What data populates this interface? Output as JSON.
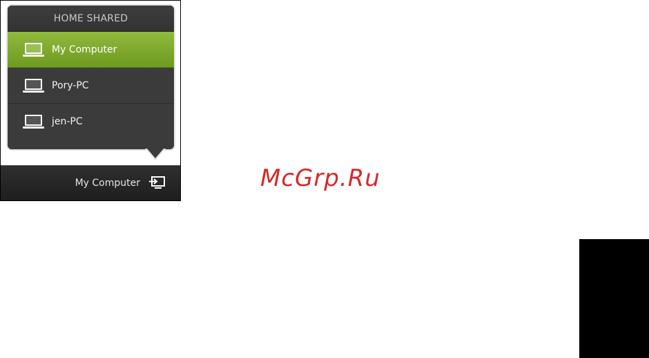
{
  "popup": {
    "title": "HOME SHARED",
    "items": [
      {
        "label": "My Computer",
        "icon": "laptop-icon",
        "selected": true
      },
      {
        "label": "Pory-PC",
        "icon": "laptop-icon",
        "selected": false
      },
      {
        "label": "jen-PC",
        "icon": "laptop-icon",
        "selected": false
      }
    ]
  },
  "bottom_bar": {
    "current_source": "My Computer",
    "icon": "switch-source-icon"
  },
  "watermark": {
    "text": "McGrp.Ru"
  },
  "colors": {
    "selected_green": "#7fa82e",
    "panel_dark": "#3b3b3b",
    "watermark_red": "#d42a2a"
  }
}
